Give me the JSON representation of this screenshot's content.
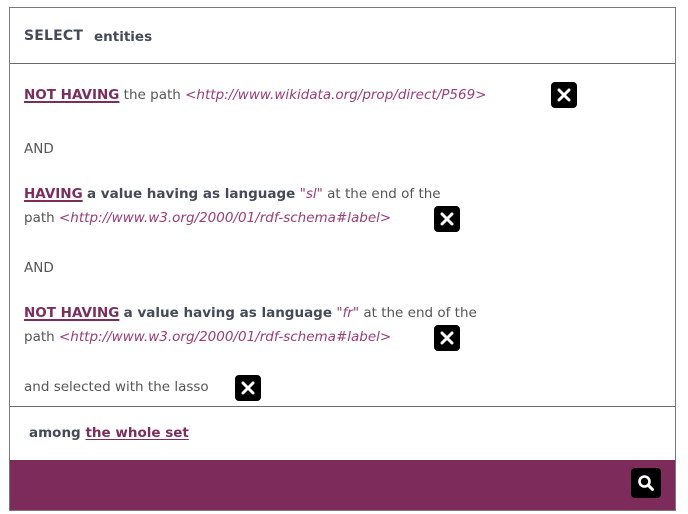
{
  "header": {
    "select_keyword": "SELECT",
    "subject": "entities"
  },
  "criteria": [
    {
      "operator": "NOT HAVING",
      "text_before": "the path",
      "path": "<http://www.wikidata.org/prop/direct/P569>"
    },
    {
      "operator": "HAVING",
      "value_text": "a value having as language",
      "language": "\"sl\"",
      "text_mid": "at the end of the",
      "text_before_path": "path",
      "path": "<http://www.w3.org/2000/01/rdf-schema#label>"
    },
    {
      "operator": "NOT HAVING",
      "value_text": "a value having as language",
      "language": "\"fr\"",
      "text_mid": "at the end of the",
      "text_before_path": "path",
      "path": "<http://www.w3.org/2000/01/rdf-schema#label>"
    }
  ],
  "conjunction": "AND",
  "lasso_text": "and selected with the lasso",
  "scope": {
    "prefix": "among",
    "link": "the whole set"
  },
  "icons": {
    "remove": "close-icon",
    "search": "search-icon"
  },
  "colors": {
    "accent": "#7b2d5e",
    "footer": "#7d2b5b",
    "uri": "#9a3d79",
    "button": "#000000"
  }
}
